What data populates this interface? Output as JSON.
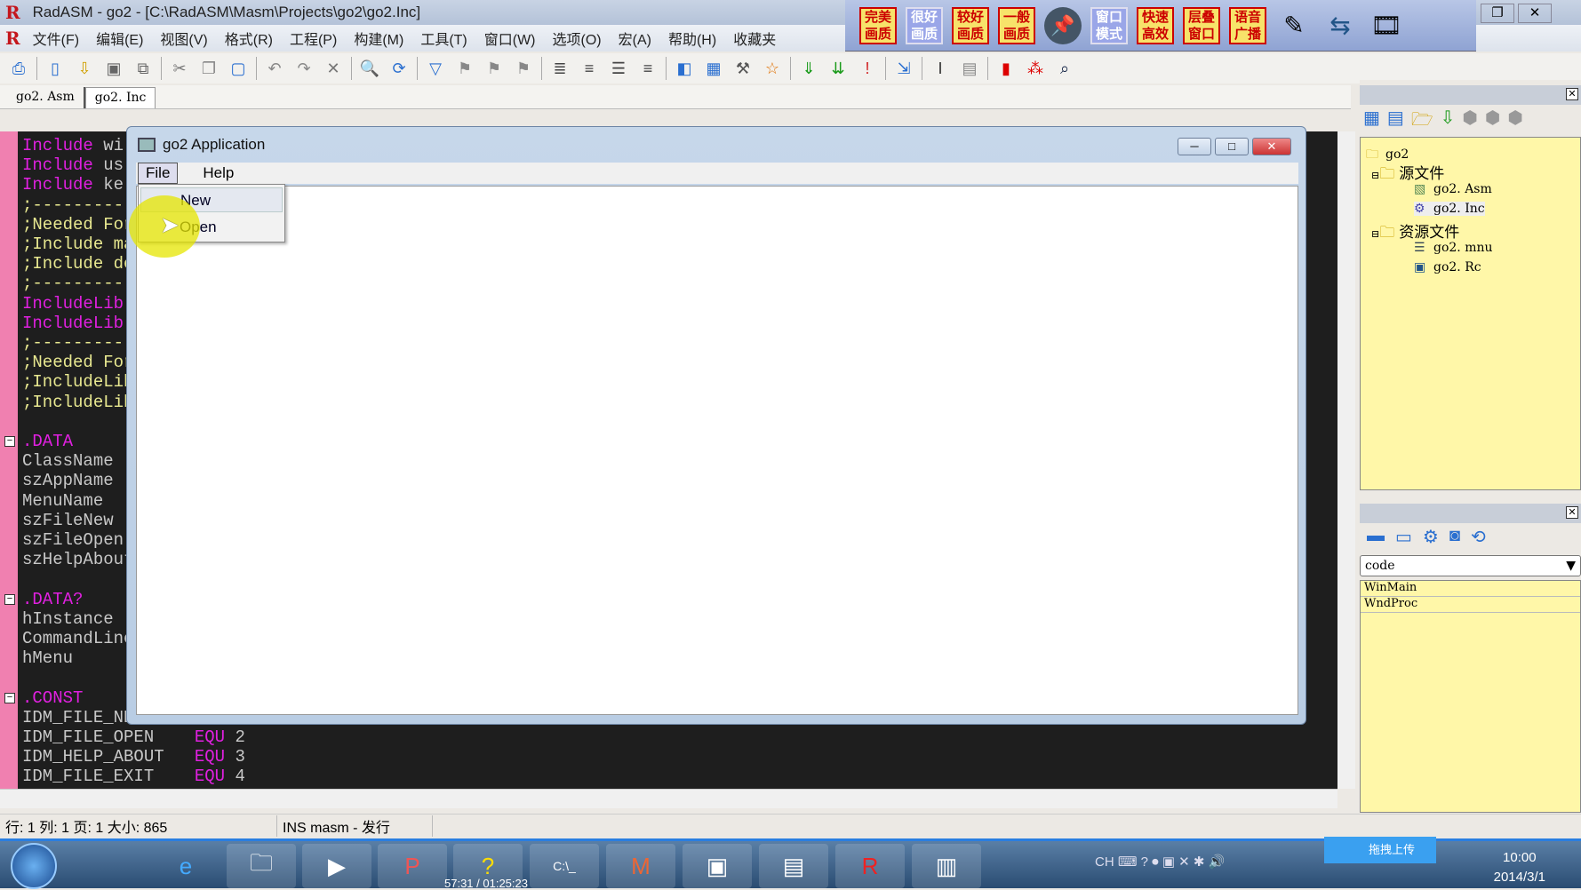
{
  "window": {
    "title": "RadASM - go2 - [C:\\RadASM\\Masm\\Projects\\go2\\go2.Inc]"
  },
  "menu": [
    "文件(F)",
    "编辑(E)",
    "视图(V)",
    "格式(R)",
    "工程(P)",
    "构建(M)",
    "工具(T)",
    "窗口(W)",
    "选项(O)",
    "宏(A)",
    "帮助(H)",
    "收藏夹"
  ],
  "floatbar": {
    "buttons": [
      "完美画质",
      "很好画质",
      "较好画质",
      "一般画质",
      "窗口模式",
      "快速高效",
      "层叠窗口",
      "语音广播"
    ]
  },
  "tabs": [
    {
      "label": "go2. Asm"
    },
    {
      "label": "go2. Inc",
      "active": true
    }
  ],
  "editor": {
    "lines": [
      {
        "kw": "Include",
        "rest": " wi",
        "cls": "mag"
      },
      {
        "kw": "Include",
        "rest": " us",
        "cls": "mag"
      },
      {
        "kw": "Include",
        "rest": " ke",
        "cls": "mag"
      },
      {
        "kw": ";----------",
        "rest": "",
        "cls": "yel"
      },
      {
        "kw": ";Needed For",
        "rest": "",
        "cls": "yel"
      },
      {
        "kw": ";Include ma",
        "rest": "",
        "cls": "yel"
      },
      {
        "kw": ";Include de",
        "rest": "",
        "cls": "yel"
      },
      {
        "kw": ";----------",
        "rest": "",
        "cls": "yel"
      },
      {
        "kw": "IncludeLib",
        "rest": "",
        "cls": "mag"
      },
      {
        "kw": "IncludeLib",
        "rest": "",
        "cls": "mag"
      },
      {
        "kw": ";----------",
        "rest": "",
        "cls": "yel"
      },
      {
        "kw": ";Needed For",
        "rest": "",
        "cls": "yel"
      },
      {
        "kw": ";IncludeLib",
        "rest": "",
        "cls": "yel"
      },
      {
        "kw": ";IncludeLib",
        "rest": "",
        "cls": "yel"
      },
      {
        "kw": "",
        "rest": "",
        "cls": "gry"
      },
      {
        "kw": ".DATA",
        "rest": "",
        "cls": "mag"
      },
      {
        "kw": "ClassName",
        "rest": "",
        "cls": "gry"
      },
      {
        "kw": "szAppName",
        "rest": "",
        "cls": "gry"
      },
      {
        "kw": "MenuName",
        "rest": "",
        "cls": "gry"
      },
      {
        "kw": "szFileNew",
        "rest": "",
        "cls": "gry"
      },
      {
        "kw": "szFileOpen",
        "rest": "",
        "cls": "gry"
      },
      {
        "kw": "szHelpAbout",
        "rest": "",
        "cls": "gry"
      },
      {
        "kw": "",
        "rest": "",
        "cls": "gry"
      },
      {
        "kw": ".DATA?",
        "rest": "",
        "cls": "mag"
      },
      {
        "kw": "hInstance",
        "rest": "",
        "cls": "gry"
      },
      {
        "kw": "CommandLine",
        "rest": "",
        "cls": "gry"
      },
      {
        "kw": "hMenu",
        "rest": "",
        "cls": "gry"
      },
      {
        "kw": "",
        "rest": "",
        "cls": "gry"
      },
      {
        "kw": ".CONST",
        "rest": "",
        "cls": "mag"
      },
      {
        "kw": "IDM_FILE_NE",
        "rest": "",
        "cls": "gry"
      },
      {
        "kw": "IDM_FILE_OPEN",
        "rest": "    EQU 2",
        "cls": "gry"
      },
      {
        "kw": "IDM_HELP_ABOUT",
        "rest": "   EQU 3",
        "cls": "gry"
      },
      {
        "kw": "IDM_FILE_EXIT",
        "rest": "    EQU 4",
        "cls": "gry"
      }
    ]
  },
  "app": {
    "title": "go2 Application",
    "menu": [
      "File",
      "Help"
    ],
    "dropdown": [
      "New",
      "Open"
    ]
  },
  "project": {
    "root": "go2",
    "groups": [
      {
        "name": "源文件",
        "files": [
          "go2. Asm",
          "go2. Inc"
        ]
      },
      {
        "name": "资源文件",
        "files": [
          "go2. mnu",
          "go2. Rc"
        ]
      }
    ]
  },
  "properties": {
    "selected": "code",
    "items": [
      "WinMain",
      "WndProc"
    ]
  },
  "status": {
    "position": "行: 1  列:  1 页: 1 大小: 865",
    "mode": "INS masm - 发行"
  },
  "taskbar": {
    "media_time": "57:31 / 01:25:23",
    "upload": "拖拽上传",
    "time": "10:00",
    "date": "2014/3/1",
    "lang": "CH"
  }
}
